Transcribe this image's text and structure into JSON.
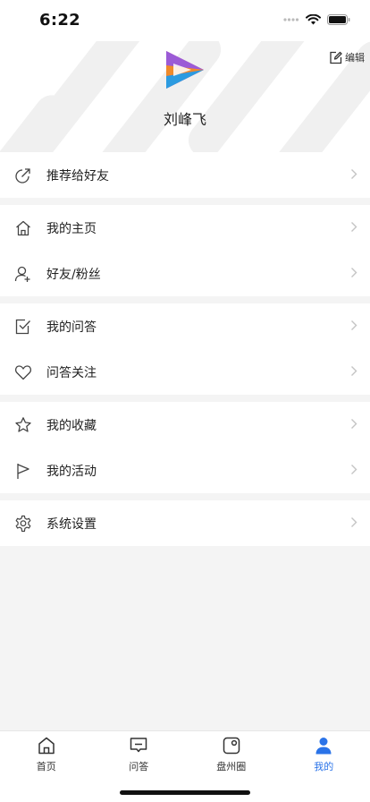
{
  "status_bar": {
    "time": "6:22"
  },
  "profile": {
    "name": "刘峰飞",
    "edit_label": "编辑"
  },
  "menu": {
    "recommend": "推荐给好友",
    "homepage": "我的主页",
    "friends": "好友/粉丝",
    "my_qa": "我的问答",
    "qa_follow": "问答关注",
    "favorites": "我的收藏",
    "activities": "我的活动",
    "settings": "系统设置"
  },
  "tabs": [
    {
      "label": "首页",
      "icon": "home-icon"
    },
    {
      "label": "问答",
      "icon": "chat-icon"
    },
    {
      "label": "盘州圈",
      "icon": "circle-icon"
    },
    {
      "label": "我的",
      "icon": "user-icon"
    }
  ],
  "colors": {
    "accent": "#2a73e8",
    "background": "#f4f4f4"
  }
}
